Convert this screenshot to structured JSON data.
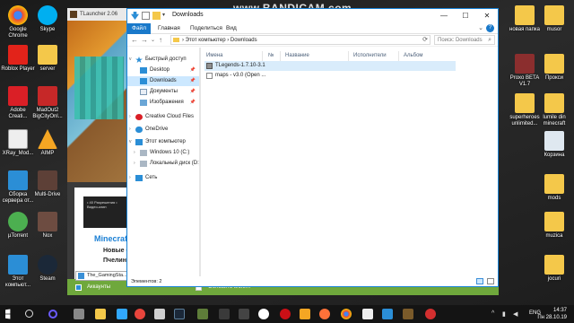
{
  "watermark": "www.BANDICAM.com",
  "desktop": {
    "left_icons": [
      {
        "label": "Google Chrome",
        "icon": "chrome-icon",
        "color": "#e8453c"
      },
      {
        "label": "Skype",
        "icon": "skype-icon",
        "color": "#00aff0"
      },
      {
        "label": "Roblox Player",
        "icon": "roblox-icon",
        "color": "#e2231a"
      },
      {
        "label": "server",
        "icon": "folder-icon",
        "color": "#f4c84a"
      },
      {
        "label": "Adobe Creati...",
        "icon": "adobe-cc-icon",
        "color": "#da1f26"
      },
      {
        "label": "MadOut2 BigCityOnl...",
        "icon": "madout-icon",
        "color": "#c62828"
      },
      {
        "label": "XRay_Mod...",
        "icon": "xray-icon",
        "color": "#3a3a3a"
      },
      {
        "label": "AIMP",
        "icon": "aimp-icon",
        "color": "#f5a623"
      },
      {
        "label": "Сборка сервера от...",
        "icon": "server-build-icon",
        "color": "#3c3c3c"
      },
      {
        "label": "Multi-Drive",
        "icon": "multidrive-icon",
        "color": "#5d4037"
      },
      {
        "label": "µTorrent",
        "icon": "utorrent-icon",
        "color": "#4caf50"
      },
      {
        "label": "Nox",
        "icon": "nox-icon",
        "color": "#6d4c41"
      },
      {
        "label": "Этот компьют...",
        "icon": "computer-icon",
        "color": "#2b8ed6"
      },
      {
        "label": "Steam",
        "icon": "steam-icon",
        "color": "#1b2838"
      }
    ],
    "right_icons": [
      {
        "label": "новая папка",
        "icon": "folder-icon",
        "color": "#f4c84a"
      },
      {
        "label": "musor",
        "icon": "folder-icon",
        "color": "#f4c84a"
      },
      {
        "label": "Proxo BETA V1.7",
        "icon": "proxo-icon",
        "color": "#8b2e2e"
      },
      {
        "label": "Прокси",
        "icon": "folder-icon",
        "color": "#f4c84a"
      },
      {
        "label": "superheroes unlimited...",
        "icon": "folder-icon",
        "color": "#f4c84a"
      },
      {
        "label": "lumile din minecraft",
        "icon": "folder-icon",
        "color": "#f4c84a"
      },
      {
        "label": "Корзина",
        "icon": "recycle-bin-icon",
        "color": "#dfe8f0"
      },
      {
        "label": "mods",
        "icon": "folder-icon",
        "color": "#f4c84a"
      },
      {
        "label": "muzica",
        "icon": "folder-icon",
        "color": "#f4c84a"
      },
      {
        "label": "jocuri",
        "icon": "folder-icon",
        "color": "#f4c84a"
      }
    ]
  },
  "tlauncher": {
    "title": "TLauncher 2.06",
    "news_box_lines": "• 40 Разрешения • Видео-клип",
    "news_title": "Minecraft 1.",
    "news_line1": "Новые блоки",
    "news_line2": "Пчелиное гне",
    "accounts_label": "Аккаунты",
    "update_client_label": "Обновить клиент",
    "gaming_tab": "The_GamingSta..."
  },
  "explorer": {
    "title": "Downloads",
    "tabs": [
      "Файл",
      "Главная",
      "Поделиться",
      "Вид"
    ],
    "address": [
      "Этот компьютер",
      "Downloads"
    ],
    "search_placeholder": "Поиск: Downloads",
    "nav": [
      {
        "label": "Быстрый доступ",
        "icon": "star-icon",
        "indent": 0,
        "arrow": "v"
      },
      {
        "label": "Desktop",
        "icon": "desktop-icon",
        "indent": 1,
        "pin": true
      },
      {
        "label": "Downloads",
        "icon": "download-folder-icon",
        "indent": 1,
        "pin": true,
        "selected": true
      },
      {
        "label": "Документы",
        "icon": "documents-icon",
        "indent": 1,
        "pin": true
      },
      {
        "label": "Изображения",
        "icon": "pictures-icon",
        "indent": 1,
        "pin": true
      },
      {
        "label": "Creative Cloud Files",
        "icon": "cc-files-icon",
        "indent": 0,
        "arrow": ">"
      },
      {
        "label": "OneDrive",
        "icon": "onedrive-icon",
        "indent": 0,
        "arrow": ">"
      },
      {
        "label": "Этот компьютер",
        "icon": "computer-icon",
        "indent": 0,
        "arrow": "v"
      },
      {
        "label": "Windows 10 (C:)",
        "icon": "drive-icon",
        "indent": 1,
        "arrow": ">"
      },
      {
        "label": "Локальный диск (D:)",
        "icon": "drive-icon",
        "indent": 1,
        "arrow": ">"
      },
      {
        "label": "Сеть",
        "icon": "network-icon",
        "indent": 0,
        "arrow": ">"
      }
    ],
    "columns": [
      "Имена",
      "№",
      "Название",
      "Исполнители",
      "Альбом"
    ],
    "files": [
      {
        "name": "TLegends-1.7.10-3.1",
        "icon": "archive-icon",
        "selected": true
      },
      {
        "name": "maps - v3.0 (Open ...",
        "icon": "document-icon",
        "selected": false
      }
    ],
    "status": "Элементов: 2"
  },
  "taskbar": {
    "apps": [
      "windows-icon",
      "search-icon",
      "cortana-icon",
      "taskview-icon",
      "explorer-icon",
      "chrome-icon",
      "photoshop-icon",
      "bullzip-icon",
      "mail-icon",
      "steam-icon",
      "minecraft-icon",
      "media-icon",
      "opera-icon",
      "aimp-icon",
      "firefox-icon",
      "chrome-icon",
      "xray-icon",
      "bandicam-icon",
      "grass-block-icon",
      "recorder-icon"
    ],
    "lang": "ENG",
    "time": "14:37",
    "date": "Пн 28.10.19"
  },
  "colors": {
    "accent": "#1979ca",
    "launcher_green": "#6fa83c",
    "selection": "#cce8ff"
  }
}
